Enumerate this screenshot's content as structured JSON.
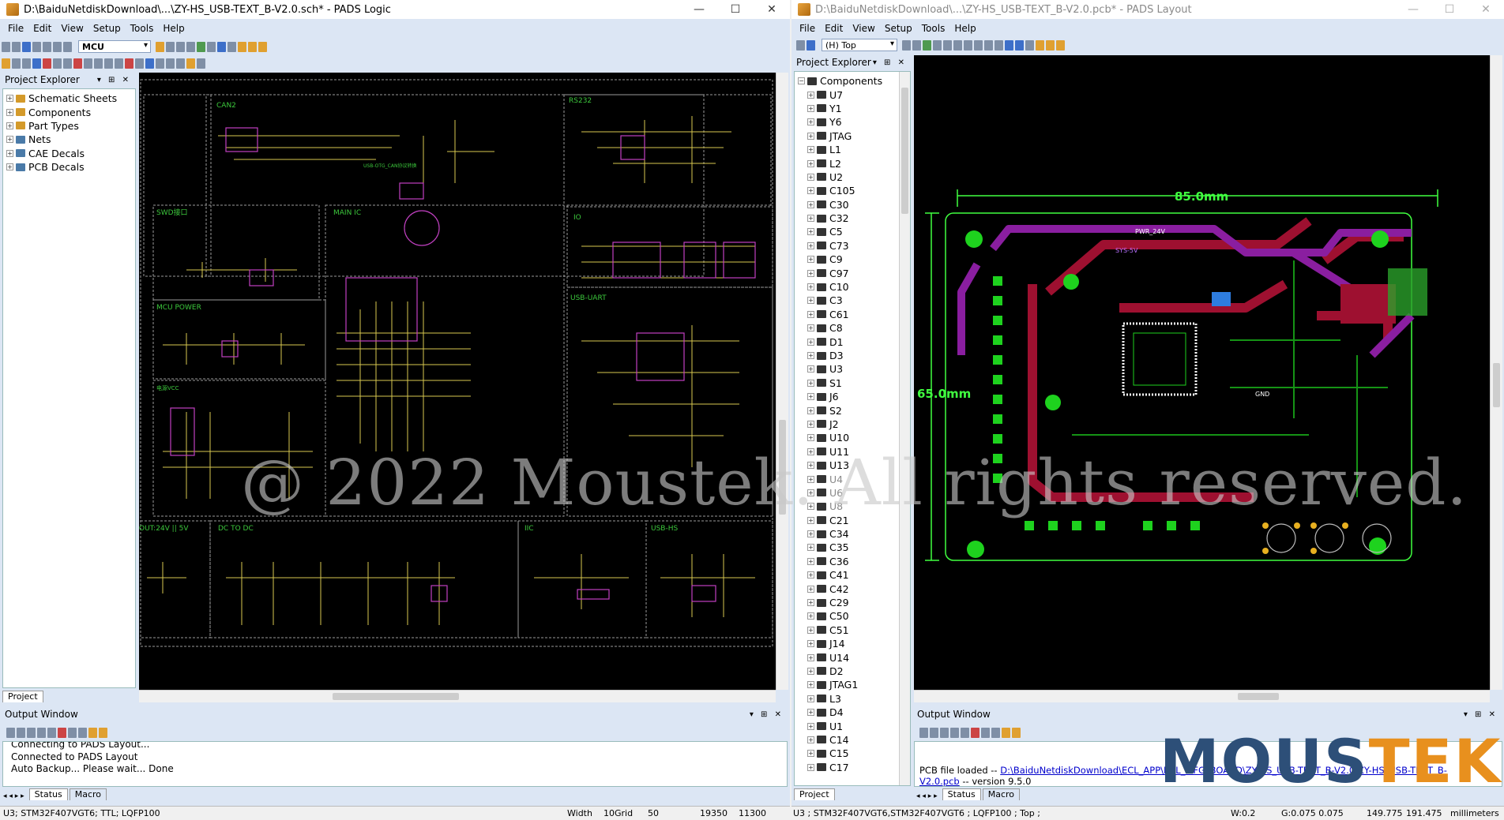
{
  "left_window": {
    "title": "D:\\BaiduNetdiskDownload\\...\\ZY-HS_USB-TEXT_B-V2.0.sch* - PADS Logic",
    "menu": [
      "File",
      "Edit",
      "View",
      "Setup",
      "Tools",
      "Help"
    ],
    "toolbar_combo": "MCU",
    "project_explorer_title": "Project Explorer",
    "tree": [
      "Schematic Sheets",
      "Components",
      "Part Types",
      "Nets",
      "CAE Decals",
      "PCB Decals"
    ],
    "project_tab": "Project",
    "schematic_labels": [
      "CAN2",
      "RS232",
      "SWD接口",
      "MAIN IC",
      "IO",
      "MCU POWER",
      "USB-UART",
      "电源VCC",
      "OUT:24V || 5V",
      "DC TO DC",
      "IIC",
      "USB-HS",
      "USB-OTG_CAN协议转换"
    ],
    "output_window_title": "Output Window",
    "output_lines": [
      "Connecting to PADS Layout...",
      "Connected to PADS Layout",
      "Auto Backup... Please wait...  Done"
    ],
    "output_tabs": [
      "Status",
      "Macro"
    ],
    "status": {
      "selection": "U3; STM32F407VGT6; TTL; LQFP100",
      "width_label": "Width",
      "width_value": "10",
      "grid_label": "Grid",
      "grid_value": "50",
      "x": "19350",
      "y": "11300"
    }
  },
  "right_window": {
    "title": "D:\\BaiduNetdiskDownload\\...\\ZY-HS_USB-TEXT_B-V2.0.pcb* - PADS Layout",
    "menu": [
      "File",
      "Edit",
      "View",
      "Setup",
      "Tools",
      "Help"
    ],
    "layer_combo": "(H) Top",
    "project_explorer_title": "Project Explorer",
    "tree_root": "Components",
    "components": [
      "U7",
      "Y1",
      "Y6",
      "JTAG",
      "L1",
      "L2",
      "U2",
      "C105",
      "C30",
      "C32",
      "C5",
      "C73",
      "C9",
      "C97",
      "C10",
      "C3",
      "C61",
      "C8",
      "D1",
      "D3",
      "U3",
      "S1",
      "J6",
      "S2",
      "J2",
      "U10",
      "U11",
      "U13",
      "U4",
      "U6",
      "U8",
      "C21",
      "C34",
      "C35",
      "C36",
      "C41",
      "C42",
      "C29",
      "C50",
      "C51",
      "J14",
      "U14",
      "D2",
      "JTAG1",
      "L3",
      "D4",
      "U1",
      "C14",
      "C15",
      "C17"
    ],
    "project_tab": "Project",
    "pcb_dimensions": {
      "width_label": "85.0mm",
      "height_label": "65.0mm"
    },
    "pcb_labels": [
      "PWR_24V",
      "SYS-5V",
      "GND"
    ],
    "output_window_title": "Output Window",
    "output_prefix": "PCB file loaded -- ",
    "output_path": "D:\\BaiduNetdiskDownload\\ECL_APP\\ECL_MFG_BOARD\\ZY-HS_USB-TEXT_B-V2.0\\ZY-HS_USB-TEXT_B-V2.0.pcb",
    "output_suffix": " -- version 9.5.0",
    "output_tabs": [
      "Status",
      "Macro"
    ],
    "status": {
      "selection": "U3 ; STM32F407VGT6,STM32F407VGT6 ; LQFP100 ; Top ;",
      "w": "W:0.2",
      "g": "G:0.075 0.075",
      "x": "149.775",
      "y": "191.475",
      "units": "millimeters"
    }
  },
  "watermark": "@ 2022 Moustek. All rights reserved.",
  "logo": {
    "part1": "MOUS",
    "part2": "TEK"
  },
  "colors": {
    "schematic_border": "#9a9a9a",
    "schematic_wire": "#d8c850",
    "schematic_part": "#c040c0",
    "schematic_label": "#3cc83c",
    "pcb_outline": "#40ff40",
    "pcb_trace_red": "#9e1030",
    "pcb_trace_purple": "#8a1ea0",
    "pcb_pad": "#1ed21e",
    "logo_blue": "#2d4f78",
    "logo_orange": "#e8901e"
  }
}
